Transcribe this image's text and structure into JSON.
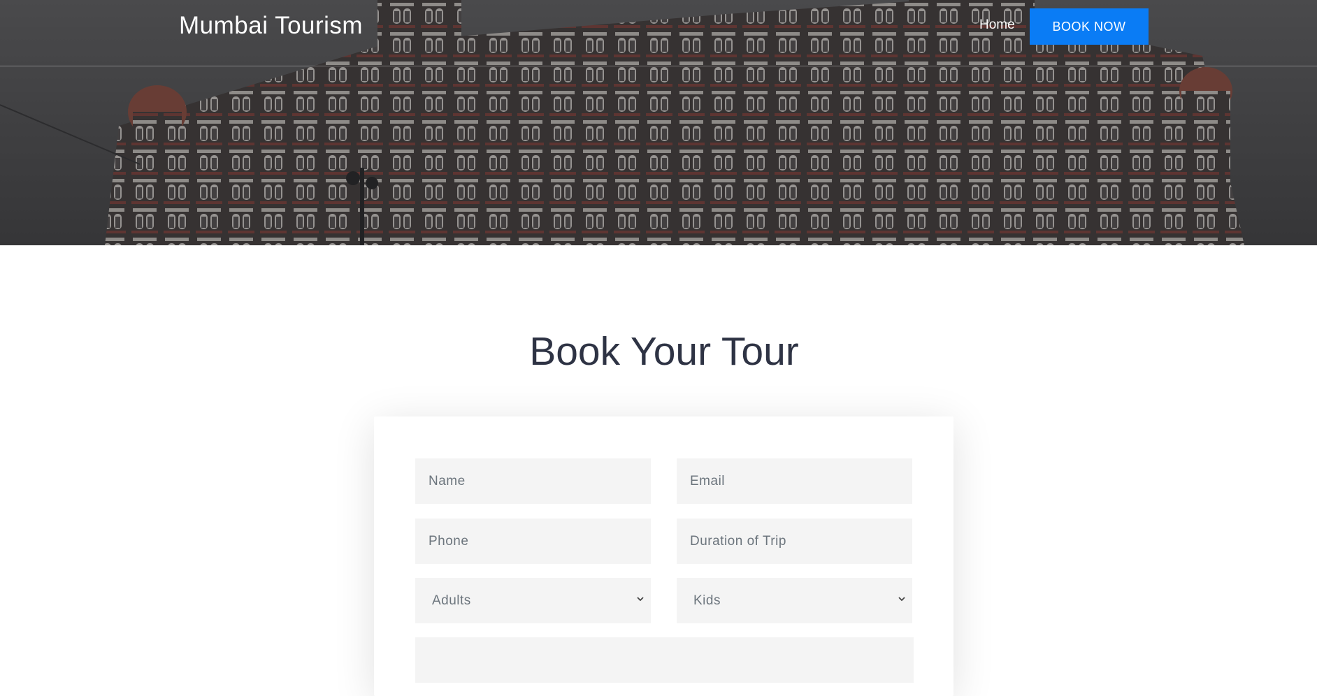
{
  "navbar": {
    "brand": "Mumbai Tourism",
    "home_label": "Home",
    "book_button_label": "BOOK NOW"
  },
  "booking": {
    "title": "Book Your Tour",
    "fields": {
      "name_placeholder": "Name",
      "email_placeholder": "Email",
      "phone_placeholder": "Phone",
      "duration_placeholder": "Duration of Trip",
      "adults_selected": "Adults",
      "kids_selected": "Kids"
    }
  },
  "colors": {
    "accent": "#0a7cf5",
    "title": "#2e3344",
    "field_bg": "#f4f4f4",
    "placeholder": "#6c757d"
  },
  "icons": {
    "select_chevron": "chevron-down-icon"
  }
}
